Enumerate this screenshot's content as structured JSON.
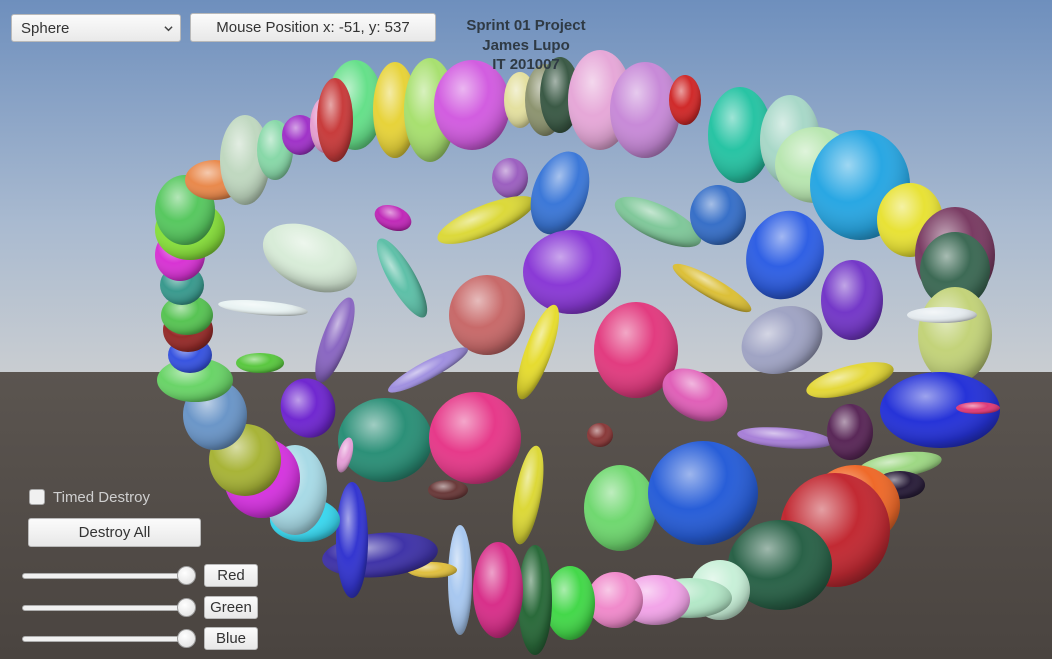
{
  "scene": {
    "name": "spheres-3d-viewport",
    "colors": {
      "sky_top": "#6e8fbd",
      "sky_mid": "#a9bad0",
      "horizon": "#c9cdd1",
      "ground": "#4d4742"
    }
  },
  "shape_select": {
    "value": "Sphere",
    "icon": "chevron-down-icon"
  },
  "mouse_position_label": "Mouse Position x: -51, y: 537",
  "title": {
    "line1": "Sprint 01 Project",
    "line2": "James Lupo",
    "line3": "IT 201007"
  },
  "timed_destroy": {
    "label": "Timed Destroy",
    "checked": false
  },
  "destroy_all_label": "Destroy All",
  "sliders": [
    {
      "label": "Red",
      "value": 1.0
    },
    {
      "label": "Green",
      "value": 1.0
    },
    {
      "label": "Blue",
      "value": 1.0
    }
  ]
}
